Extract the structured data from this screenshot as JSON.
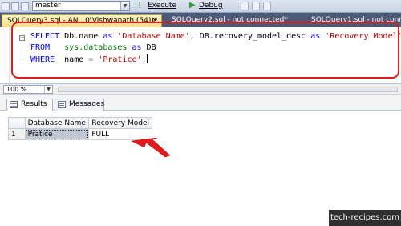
{
  "toolbar": {
    "database": "master",
    "execute_label": "Execute",
    "debug_label": "Debug"
  },
  "tabs": [
    {
      "label": "SQLQuery3.sql - AN...0\\Vishwanath (54))*",
      "close": "×",
      "active": true
    },
    {
      "label": "SQLQuery2.sql - not connected*",
      "active": false
    },
    {
      "label": "SQLQuery1.sql - not connecte",
      "active": false
    }
  ],
  "editor": {
    "line1": {
      "kw1": "SELECT",
      "t1": " Db.name ",
      "kw2": "as",
      "t2": " ",
      "s1": "'Database Name'",
      "t3": ", DB.recovery_model_desc ",
      "kw3": "as",
      "t4": " ",
      "s2": "'Recovery Model'"
    },
    "line2": {
      "kw1": "FROM",
      "t1": "   ",
      "sys": "sys.databases",
      "t2": " ",
      "kw2": "as",
      "t3": " DB"
    },
    "line3": {
      "kw1": "WHERE",
      "t1": "  name ",
      "eq": "=",
      "t2": " ",
      "s1": "'Pratice'",
      "semi": ";"
    },
    "collapse_glyph": "−"
  },
  "zoom": {
    "value": "100 %"
  },
  "result_tabs": {
    "results": "Results",
    "messages": "Messages"
  },
  "grid": {
    "columns": [
      "Database Name",
      "Recovery Model"
    ],
    "rows": [
      {
        "num": "1",
        "database_name": "Pratice",
        "recovery_model": "FULL"
      }
    ]
  },
  "watermark": "tech-recipes.com",
  "colors": {
    "keyword": "#0000ff",
    "string": "#c00000",
    "system_object": "#008000",
    "highlight": "#e21a1a",
    "active_tab": "#f8dd86"
  }
}
